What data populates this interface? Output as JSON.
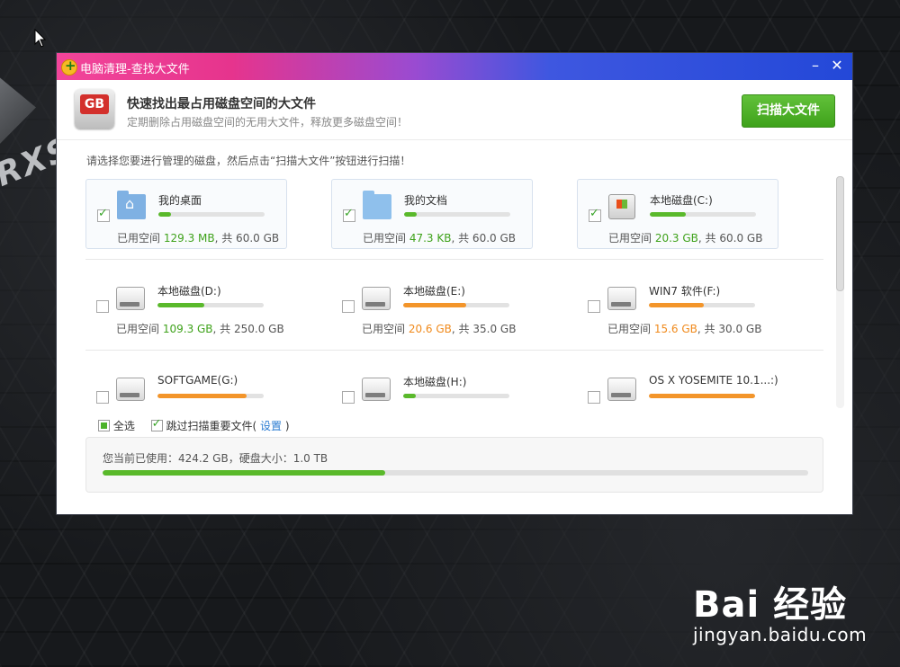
{
  "window": {
    "title": "电脑清理-查找大文件",
    "min_symbol": "–",
    "close_symbol": "✕"
  },
  "header": {
    "title": "快速找出最占用磁盘空间的大文件",
    "subtitle": "定期删除占用磁盘空间的无用大文件，释放更多磁盘空间！",
    "icon_text": "GB",
    "scan_button": "扫描大文件"
  },
  "instruction": "请选择您要进行管理的磁盘，然后点击“扫描大文件”按钮进行扫描！",
  "drives": [
    {
      "name": "我的桌面",
      "icon": "desktop-folder-icon",
      "checked": true,
      "used_label": "已用空间",
      "used": "129.3 MB",
      "total": ", 共 60.0 GB",
      "fill": 0.12,
      "color": "green"
    },
    {
      "name": "我的文档",
      "icon": "documents-folder-icon",
      "checked": true,
      "used_label": "已用空间",
      "used": "47.3 KB",
      "total": ", 共 60.0 GB",
      "fill": 0.12,
      "color": "green"
    },
    {
      "name": "本地磁盘(C:)",
      "icon": "system-drive-icon",
      "checked": true,
      "used_label": "已用空间",
      "used": "20.3 GB",
      "total": ", 共 60.0 GB",
      "fill": 0.34,
      "color": "green"
    },
    {
      "name": "本地磁盘(D:)",
      "icon": "hard-drive-icon",
      "checked": false,
      "used_label": "已用空间",
      "used": "109.3 GB",
      "total": ", 共 250.0 GB",
      "fill": 0.44,
      "color": "green"
    },
    {
      "name": "本地磁盘(E:)",
      "icon": "hard-drive-icon",
      "checked": false,
      "used_label": "已用空间",
      "used": "20.6 GB",
      "total": ", 共 35.0 GB",
      "fill": 0.59,
      "color": "orange"
    },
    {
      "name": "WIN7 软件(F:)",
      "icon": "hard-drive-icon",
      "checked": false,
      "used_label": "已用空间",
      "used": "15.6 GB",
      "total": ", 共 30.0 GB",
      "fill": 0.52,
      "color": "orange"
    },
    {
      "name": "SOFTGAME(G:)",
      "icon": "hard-drive-icon",
      "checked": false,
      "used_label": "",
      "used": "",
      "total": "",
      "fill": 0.84,
      "color": "orange"
    },
    {
      "name": "本地磁盘(H:)",
      "icon": "hard-drive-icon",
      "checked": false,
      "used_label": "",
      "used": "",
      "total": "",
      "fill": 0.12,
      "color": "green"
    },
    {
      "name": "OS X YOSEMITE 10.1...:)",
      "icon": "hard-drive-icon",
      "checked": false,
      "used_label": "",
      "used": "",
      "total": "",
      "fill": 1.0,
      "color": "orange"
    }
  ],
  "options": {
    "select_all": "全选",
    "skip_important": "跳过扫描重要文件(",
    "settings_link": "设置",
    "close_paren": ")"
  },
  "summary": {
    "text": "您当前已使用：424.2 GB，硬盘大小：1.0 TB",
    "fill": 0.4
  },
  "watermark": {
    "main": "Bai  经验",
    "sub": "jingyan.baidu.com"
  }
}
